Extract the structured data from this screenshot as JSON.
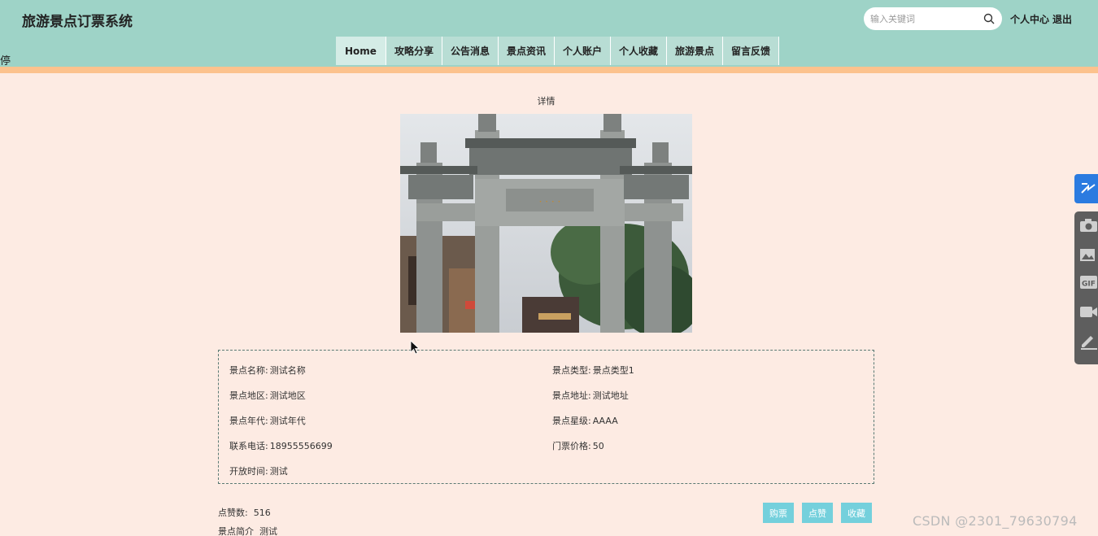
{
  "header": {
    "title": "旅游景点订票系统",
    "side_glyph": "停",
    "search": {
      "placeholder": "输入关键词",
      "value": ""
    },
    "user_center": "个人中心",
    "logout": "退出"
  },
  "nav": {
    "items": [
      {
        "label": "Home"
      },
      {
        "label": "攻略分享"
      },
      {
        "label": "公告消息"
      },
      {
        "label": "景点资讯"
      },
      {
        "label": "个人账户"
      },
      {
        "label": "个人收藏"
      },
      {
        "label": "旅游景点"
      },
      {
        "label": "留言反馈"
      }
    ]
  },
  "detail": {
    "title": "详情",
    "fields": {
      "name_label": "景点名称:",
      "name_value": "测试名称",
      "type_label": "景点类型:",
      "type_value": "景点类型1",
      "region_label": "景点地区:",
      "region_value": "测试地区",
      "address_label": "景点地址:",
      "address_value": "测试地址",
      "era_label": "景点年代:",
      "era_value": "测试年代",
      "rating_label": "景点星级:",
      "rating_value": "AAAA",
      "phone_label": "联系电话:",
      "phone_value": "18955556699",
      "price_label": "门票价格:",
      "price_value": "50",
      "hours_label": "开放时间:",
      "hours_value": "测试"
    },
    "likes_label": "点赞数:",
    "likes_value": "516",
    "intro_label": "景点简介",
    "intro_value": "测试"
  },
  "actions": {
    "buy": "购票",
    "like": "点赞",
    "favorite": "收藏"
  },
  "watermark": "CSDN @2301_79630794",
  "colors": {
    "header_bg": "#9ed3c7",
    "accent_bar": "#fcc28d",
    "page_bg": "#fdebe3",
    "button_bg": "#74d0dc",
    "tool_blue": "#2b7be0"
  },
  "icons": [
    "search-icon",
    "share-icon",
    "camera-icon",
    "image-icon",
    "gif-icon",
    "video-icon",
    "pen-icon"
  ]
}
